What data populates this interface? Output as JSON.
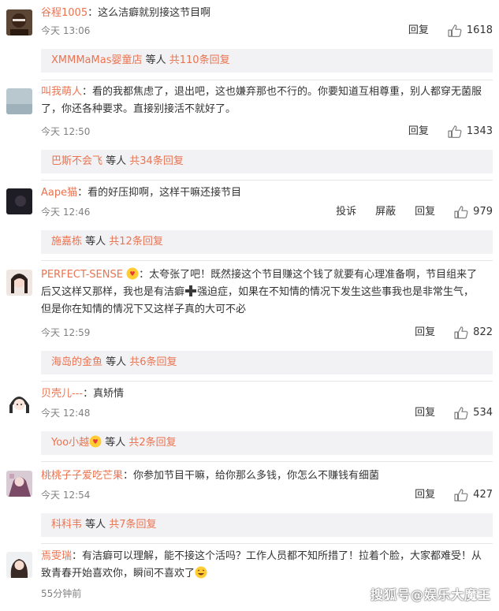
{
  "comments": [
    {
      "user": "谷程1005",
      "text": "：这么洁癖就别接这节目啊",
      "time": "今天 13:06",
      "reply_label": "回复",
      "likes": "1618",
      "replies": {
        "user": "XMMMaMas婴童店",
        "mid": " 等人 ",
        "count": "共110条回复"
      }
    },
    {
      "user": "叫我萌人",
      "text_line1": "：看的我都焦虑了，退出吧，这也嫌弃那也不行的。你要知道互相尊重，别人都穿无菌服",
      "text_line2": "了，你还各种要求。直接别接活不就好了。",
      "time": "今天 12:50",
      "reply_label": "回复",
      "likes": "1343",
      "replies": {
        "user": "巴斯不会飞",
        "mid": " 等人 ",
        "count": "共34条回复"
      }
    },
    {
      "user": "Aape猫",
      "text": "：看的好压抑啊，这样干嘛还接节目",
      "time": "今天 12:46",
      "report_label": "投诉",
      "block_label": "屏蔽",
      "reply_label": "回复",
      "likes": "979",
      "replies": {
        "user": "施嘉栋",
        "mid": " 等人 ",
        "count": "共12条回复"
      }
    },
    {
      "user": "PERFECT-SENSE",
      "text_line1": "：太夸张了吧！既然接这个节目赚这个钱了就要有心理准备啊，节目组来了",
      "text_line2a": "后又这样又那样，我也是有洁癖",
      "text_line2b": "强迫症，如果在不知情的情况下发生这些事我也是非常生气，",
      "text_line3": "但是你在知情的情况下又这样子真的大可不必",
      "time": "今天 12:59",
      "reply_label": "回复",
      "likes": "822",
      "replies": {
        "user": "海岛的金鱼",
        "mid": " 等人 ",
        "count": "共6条回复"
      }
    },
    {
      "user": "贝壳儿---",
      "text": "：真矫情",
      "time": "今天 12:48",
      "reply_label": "回复",
      "likes": "534",
      "replies": {
        "user": "Yoo小越",
        "mid": " 等人 ",
        "count": "共2条回复"
      }
    },
    {
      "user": "桃桃子子爱吃芒果",
      "text": "：你参加节目干嘛，给你那么多钱，你怎么不赚钱有细菌",
      "time": "今天 12:54",
      "reply_label": "回复",
      "likes": "427",
      "replies": {
        "user": "科科韦",
        "mid": " 等人 ",
        "count": "共7条回复"
      }
    },
    {
      "user": "焉雯瑞",
      "text_line1": "：有洁癖可以理解，能不接这个活吗？工作人员都不知所措了！拉着个脸，大家都难受！从",
      "text_line2": "致青春开始喜欢你，瞬间不喜欢了",
      "time": "55分钟前",
      "likes": "2"
    }
  ],
  "watermark": "搜狐号@娱乐大魔王",
  "colors": {
    "username": "#eb7350",
    "reply_bg": "#f2f2f5",
    "meta": "#808080",
    "divider": "#e6e6e6"
  },
  "icons": [
    "thumbs-up-icon",
    "heart-emoji-icon",
    "plus-emoji-icon",
    "laugh-emoji-icon"
  ]
}
